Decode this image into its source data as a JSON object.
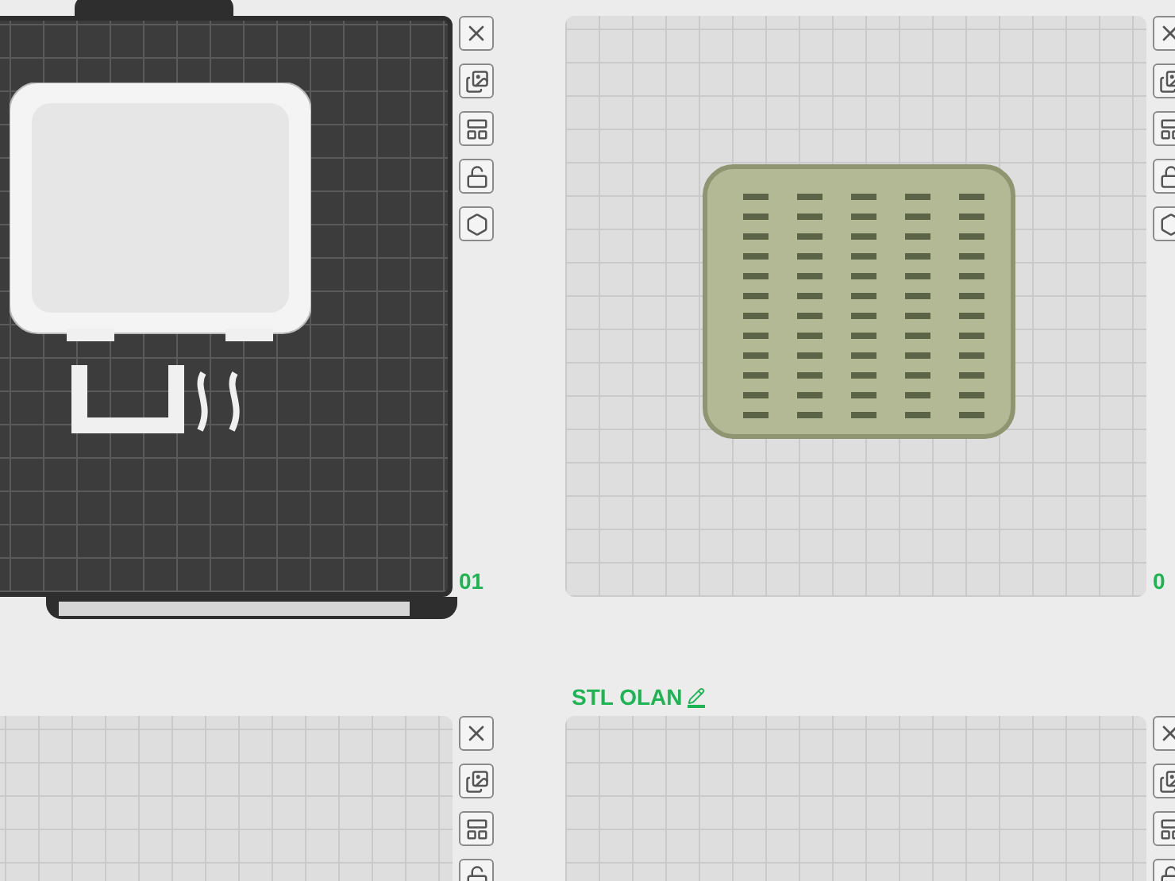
{
  "plates": [
    {
      "number": "01",
      "selected": true,
      "kind": "frame-parts"
    },
    {
      "number": "0",
      "selected": false,
      "kind": "vent-panel"
    },
    {
      "selected": false,
      "kind": "empty"
    },
    {
      "title": "STL OLAN",
      "selected": false,
      "kind": "empty"
    }
  ]
}
